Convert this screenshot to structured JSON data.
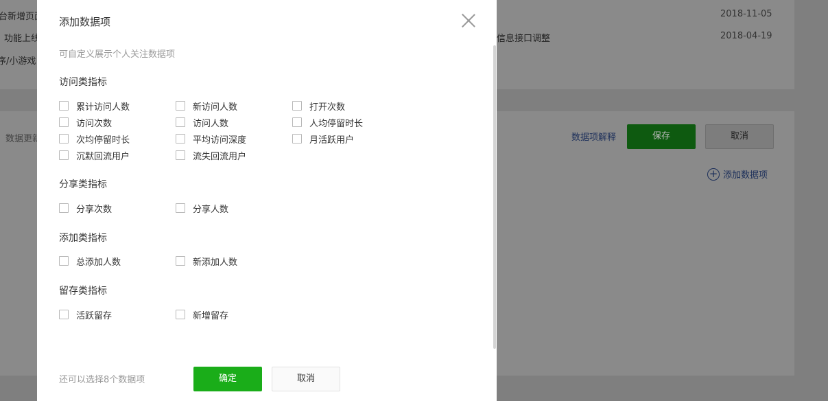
{
  "background": {
    "rows": [
      {
        "text": "台新增页面",
        "date": "2018-11-05"
      },
      {
        "text": "功能上线",
        "middle": "信息接口调整",
        "date": "2018-04-19"
      },
      {
        "text": "序/小游戏"
      }
    ],
    "section_label": "数据更新",
    "explain_link": "数据项解释",
    "save_label": "保存",
    "cancel_label": "取消",
    "add_label": "添加数据项"
  },
  "dialog": {
    "title": "添加数据项",
    "description": "可自定义展示个人关注数据项",
    "groups": [
      {
        "title": "访问类指标",
        "items": [
          "累计访问人数",
          "新访问人数",
          "打开次数",
          "访问次数",
          "访问人数",
          "人均停留时长",
          "次均停留时长",
          "平均访问深度",
          "月活跃用户",
          "沉默回流用户",
          "流失回流用户"
        ]
      },
      {
        "title": "分享类指标",
        "items": [
          "分享次数",
          "分享人数"
        ]
      },
      {
        "title": "添加类指标",
        "items": [
          "总添加人数",
          "新添加人数"
        ]
      },
      {
        "title": "留存类指标",
        "items": [
          "活跃留存",
          "新增留存"
        ]
      }
    ],
    "remaining_text": "还可以选择8个数据项",
    "ok_label": "确定",
    "cancel_label": "取消"
  }
}
